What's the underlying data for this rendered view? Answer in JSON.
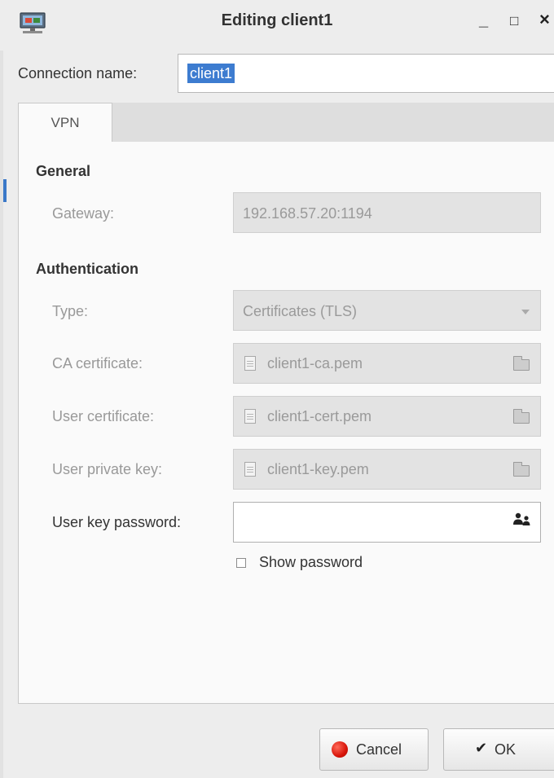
{
  "window": {
    "title": "Editing client1",
    "minimize_glyph": "_",
    "maximize_glyph": "□",
    "close_glyph": "×",
    "icon": "network-connection-icon"
  },
  "connection": {
    "label": "Connection name:",
    "value": "client1"
  },
  "tabs": [
    {
      "label": "VPN",
      "selected": true
    }
  ],
  "general": {
    "heading": "General",
    "gateway_label": "Gateway:",
    "gateway_value": "192.168.57.20:1194"
  },
  "authentication": {
    "heading": "Authentication",
    "type_label": "Type:",
    "type_value": "Certificates (TLS)",
    "ca_label": "CA certificate:",
    "ca_value": "client1-ca.pem",
    "user_cert_label": "User certificate:",
    "user_cert_value": "client1-cert.pem",
    "user_key_label": "User private key:",
    "user_key_value": "client1-key.pem",
    "password_label": "User key password:",
    "password_value": "",
    "show_password_label": "Show password",
    "show_password_checked": false
  },
  "buttons": {
    "cancel_label": "Cancel",
    "ok_label": "OK",
    "ok_glyph": "✔"
  },
  "colors": {
    "selection": "#3d7cd0",
    "cancel_icon": "#d8150a"
  }
}
